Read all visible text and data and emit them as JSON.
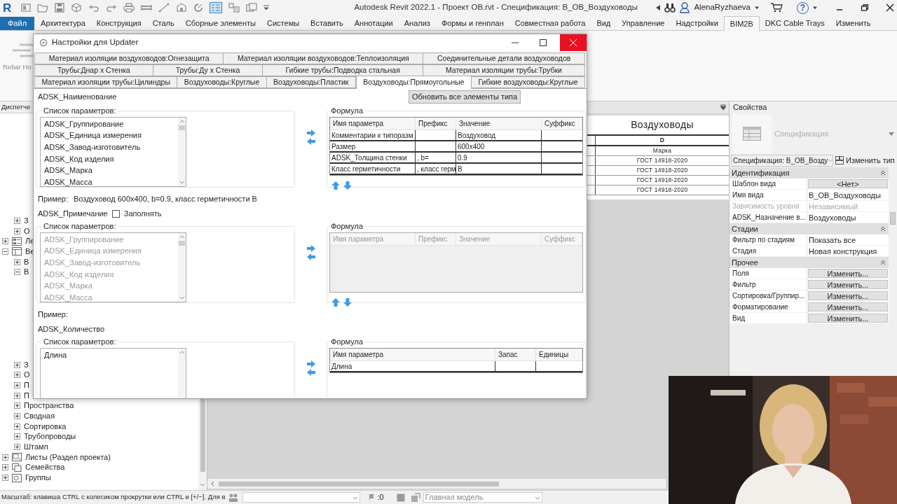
{
  "title_bar": {
    "app_logo": "R",
    "title": "Autodesk Revit 2022.1 - Проект ОВ.rvt - Спецификация: В_ОВ_Воздуховоды",
    "user": "AlenaRyzhaeva",
    "help": "?"
  },
  "ribbon": {
    "tabs": [
      {
        "label": "Файл",
        "kind": "file",
        "selected": false
      },
      {
        "label": "Архитектура",
        "kind": "tab",
        "selected": false
      },
      {
        "label": "Конструкция",
        "kind": "tab",
        "selected": false
      },
      {
        "label": "Сталь",
        "kind": "tab",
        "selected": false
      },
      {
        "label": "Сборные элементы",
        "kind": "tab",
        "selected": false
      },
      {
        "label": "Системы",
        "kind": "tab",
        "selected": false
      },
      {
        "label": "Вставить",
        "kind": "tab",
        "selected": false
      },
      {
        "label": "Аннотации",
        "kind": "tab",
        "selected": false
      },
      {
        "label": "Анализ",
        "kind": "tab",
        "selected": false
      },
      {
        "label": "Формы и генплан",
        "kind": "tab",
        "selected": false
      },
      {
        "label": "Совместная работа",
        "kind": "tab",
        "selected": false
      },
      {
        "label": "Вид",
        "kind": "tab",
        "selected": false
      },
      {
        "label": "Управление",
        "kind": "tab",
        "selected": false
      },
      {
        "label": "Надстройки",
        "kind": "tab",
        "selected": false
      },
      {
        "label": "BIM2B",
        "kind": "tab",
        "selected": true
      },
      {
        "label": "DKC Cable Trays",
        "kind": "tab",
        "selected": false
      },
      {
        "label": "Изменить",
        "kind": "tab",
        "selected": false
      }
    ],
    "tool": "Rebar Ho"
  },
  "browser": {
    "title": "Диспетче",
    "hidden_branch_children": [
      {
        "label": "З",
        "expanded": false
      },
      {
        "label": "О",
        "expanded": false
      }
    ],
    "tree": [
      {
        "label": "Ле",
        "kind": "legend",
        "expanded": false
      },
      {
        "label": "Ве",
        "kind": "schedule",
        "expanded": true,
        "children": [
          {
            "label": "В",
            "expanded": false
          },
          {
            "label": "В",
            "expanded": true
          },
          {
            "label": "З",
            "expanded": false
          },
          {
            "label": "О",
            "expanded": false
          },
          {
            "label": "П",
            "expanded": false
          },
          {
            "label": "П",
            "expanded": false
          },
          {
            "label": "Пространства",
            "expanded": false
          },
          {
            "label": "Сводная",
            "expanded": false
          },
          {
            "label": "Сортировка",
            "expanded": false
          },
          {
            "label": "Трубопроводы",
            "expanded": false
          },
          {
            "label": "Штамп",
            "expanded": false
          }
        ]
      },
      {
        "label": "Листы (Раздел проекта)",
        "kind": "sheet",
        "expanded": false
      },
      {
        "label": "Семейства",
        "kind": "family",
        "expanded": false
      },
      {
        "label": "Группы",
        "kind": "group",
        "expanded": false
      }
    ]
  },
  "schedule": {
    "title": "Воздуховоды",
    "column": "D",
    "header": "Марка",
    "rows": [
      "ГОСТ 14918-2020",
      "ГОСТ 14918-2020",
      "ГОСТ 14918-2020",
      "ГОСТ 14918-2020"
    ]
  },
  "properties": {
    "title": "Свойства",
    "type_name": "Спецификация",
    "selector": "Спецификация: В_ОВ_Возду",
    "edit_type": "Изменить тип",
    "groups": [
      {
        "name": "Идентификация",
        "expanded": true,
        "rows": [
          {
            "label": "Шаблон вида",
            "value": "<Нет>",
            "kind": "button",
            "disabled": false
          },
          {
            "label": "Имя вида",
            "value": "В_ОВ_Воздуховоды",
            "kind": "text",
            "disabled": false
          },
          {
            "label": "Зависимость уровня",
            "value": "Независимый",
            "kind": "text",
            "disabled": true
          },
          {
            "label": "ADSK_Назначение в...",
            "value": "Воздуховоды",
            "kind": "text",
            "disabled": false
          }
        ]
      },
      {
        "name": "Стадии",
        "expanded": true,
        "rows": [
          {
            "label": "Фильтр по стадиям",
            "value": "Показать все",
            "kind": "text",
            "disabled": false
          },
          {
            "label": "Стадия",
            "value": "Новая конструкция",
            "kind": "text",
            "disabled": false
          }
        ]
      },
      {
        "name": "Прочее",
        "expanded": true,
        "rows": [
          {
            "label": "Поля",
            "value": "Изменить...",
            "kind": "button",
            "disabled": false
          },
          {
            "label": "Фильтр",
            "value": "Изменить...",
            "kind": "button",
            "disabled": false
          },
          {
            "label": "Сортировка/Группир...",
            "value": "Изменить...",
            "kind": "button",
            "disabled": false
          },
          {
            "label": "Форматирование",
            "value": "Изменить...",
            "kind": "button",
            "disabled": false
          },
          {
            "label": "Вид",
            "value": "Изменить...",
            "kind": "button",
            "disabled": false
          }
        ]
      }
    ]
  },
  "dialog": {
    "title": "Настройки для Updater",
    "tab_rows": [
      [
        {
          "label": "Материал изоляции воздуховодов:Огнезащита",
          "selected": false
        },
        {
          "label": "Материал изоляции воздуховодов:Теплоизоляция",
          "selected": false
        },
        {
          "label": "Соединительные детали воздуховодов",
          "selected": false
        }
      ],
      [
        {
          "label": "Трубы:Днар х Стенка",
          "selected": false
        },
        {
          "label": "Трубы:Ду х Стенка",
          "selected": false
        },
        {
          "label": "Гибкие трубы:Подводка стальная",
          "selected": false
        },
        {
          "label": "Материал изоляции трубы:Трубки",
          "selected": false
        }
      ],
      [
        {
          "label": "Материал изоляции трубы:Цилиндры",
          "selected": false
        },
        {
          "label": "Воздуховоды:Круглые",
          "selected": false
        },
        {
          "label": "Воздуховоды:Пластик",
          "selected": false
        },
        {
          "label": "Воздуховоды:Прямоугольные",
          "selected": true
        },
        {
          "label": "Гибкие воздуховоды:Круглые",
          "selected": false
        }
      ]
    ],
    "sections": [
      {
        "parameter": "ADSK_Наименование",
        "update_button": "Обновить все элементы типа",
        "disabled": false,
        "list_label": "Список параметров:",
        "list": [
          "ADSK_Группирование",
          "ADSK_Единица измерения",
          "ADSK_Завод-изготовитель",
          "ADSK_Код изделия",
          "ADSK_Марка",
          "ADSK_Масса"
        ],
        "formula": {
          "label": "Формула",
          "columns": [
            "Имя параметра",
            "Префикс",
            "Значение",
            "Суффикс"
          ],
          "rows": [
            {
              "name": "Комментарии к типоразм",
              "value": "Воздуховод"
            },
            {
              "name": "Размер",
              "value": "600x400"
            },
            {
              "name": "ADSK_Толщина стенки",
              "prefix": ", b=",
              "value": "0.9"
            },
            {
              "name": "Класс герметичности",
              "prefix": ", класс герм",
              "value": "В"
            }
          ]
        },
        "example_label": "Пример:",
        "example": "Воздуховод 600x400, b=0.9, класс герметичности В"
      },
      {
        "parameter": "ADSK_Примечание",
        "fill_checkbox": {
          "label": "Заполнять",
          "checked": false
        },
        "disabled": true,
        "list_label": "Список параметров:",
        "list": [
          "ADSK_Группирование",
          "ADSK_Единица измерения",
          "ADSK_Завод-изготовитель",
          "ADSK_Код изделия",
          "ADSK_Марка",
          "ADSK_Масса"
        ],
        "formula": {
          "label": "Формула",
          "columns": [
            "Имя параметра",
            "Префикс",
            "Значение",
            "Суффикс"
          ]
        },
        "example_label": "Пример:"
      },
      {
        "parameter": "ADSK_Количество",
        "disabled": false,
        "list_label": "Список параметров:",
        "list": [
          "Длина"
        ],
        "formula": {
          "label": "Формула",
          "columns": [
            "Имя параметра",
            "Запас",
            "Единицы"
          ],
          "rows": [
            {
              "name": "Длина"
            }
          ]
        }
      }
    ]
  },
  "status_bar": {
    "hint": "Масштаб: клавиша CTRL с колесиком прокрутки или CTRL и [+/−]. Для в",
    "counter": ":0",
    "workset": "Главная модель"
  }
}
